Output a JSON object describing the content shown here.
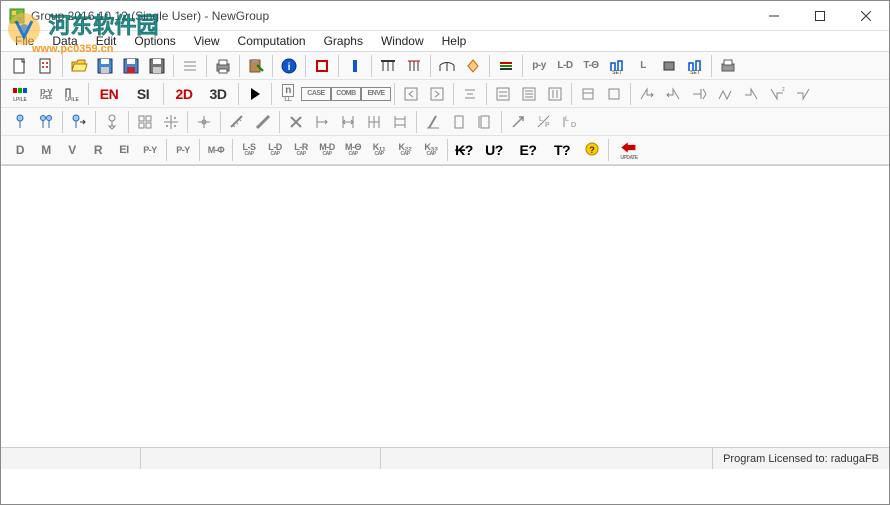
{
  "window": {
    "title": "Group 2016.10.12 (Single User) - NewGroup"
  },
  "menu": {
    "items": [
      "File",
      "Data",
      "Edit",
      "Options",
      "View",
      "Computation",
      "Graphs",
      "Window",
      "Help"
    ]
  },
  "toolbar1": {
    "buttons": [
      "new",
      "new-dots",
      "open",
      "save",
      "save-red",
      "save-bw",
      "lines",
      "print",
      "print-arrow",
      "space",
      "info-circle",
      "square-red",
      "square-blue",
      "bar",
      "columns",
      "lines-t",
      "bridge",
      "diamond",
      "hlines",
      "space",
      "py",
      "ld",
      "t0",
      "set-blue",
      "l",
      "rect",
      "set-blue2",
      "space",
      "print2"
    ]
  },
  "toolbar2": {
    "lpile1": "LPILE",
    "lpile2": "LPILE",
    "lpile3": "LPILE",
    "en": "EN",
    "si": "SI",
    "d2": "2D",
    "d3": "3D",
    "n": "n",
    "case": "CASE",
    "comb": "COMB",
    "enve": "ENVE"
  },
  "toolbar5": {
    "d": "D",
    "m": "M",
    "v": "V",
    "r": "R",
    "ei": "EI",
    "py1": "P-Y",
    "py2": "P-Y",
    "mf": "M-Φ",
    "ls": "L-S",
    "ld": "L-D",
    "lr": "L-R",
    "md": "M-D",
    "m0": "M-Θ",
    "k11": "K₁₁",
    "k22": "K₂₂",
    "k33": "K₃₃",
    "q": "₭?",
    "u": "U?",
    "e": "E?",
    "t": "T?",
    "update": "UPDATE"
  },
  "status": {
    "license": "Program Licensed to: radugaFB"
  },
  "watermark": {
    "text1": "河东软件园",
    "text2": "www.pc0359.cn"
  }
}
